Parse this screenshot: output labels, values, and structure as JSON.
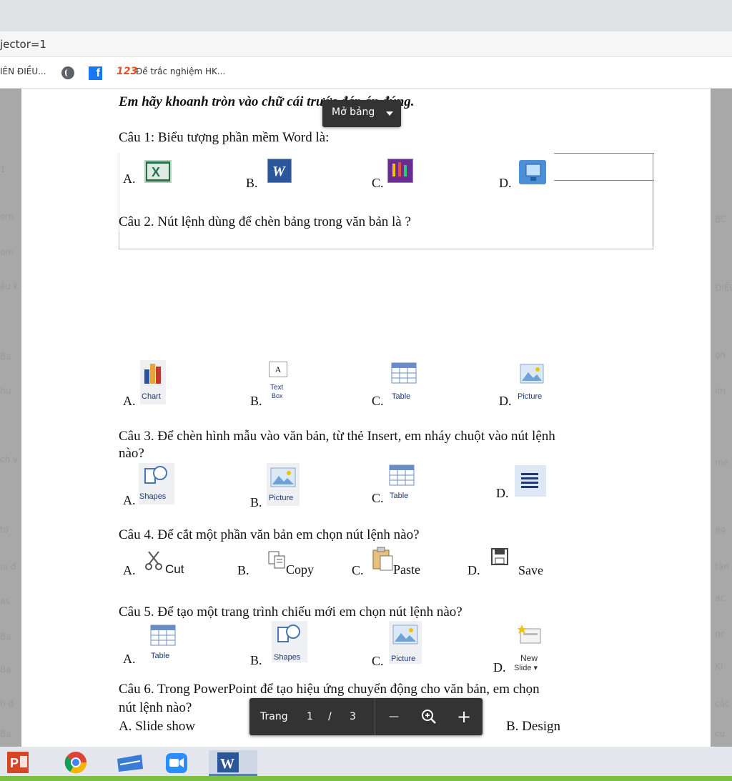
{
  "browser": {
    "address_fragment": "jector=1",
    "bookmarks": {
      "item1": "IÊN ĐIỀU...",
      "item2_prefix": "123",
      "item2": "Đề trắc nghiệm HK..."
    }
  },
  "viewer": {
    "open_table_button": "Mở bảng",
    "page_controls": {
      "page_label": "Trang",
      "current_page": "1",
      "separator": "/",
      "total_pages": "3",
      "zoom_out": "—",
      "zoom_in": "+"
    }
  },
  "document": {
    "instruction": "Em hãy khoanh tròn vào chữ cái trước đáp án đúng.",
    "q1": {
      "text": "Câu 1: Biểu tượng phần mềm Word là:",
      "options": [
        "A.",
        "B.",
        "C.",
        "D."
      ]
    },
    "q2": {
      "text": "Câu 2. Nút lệnh dùng để chèn bảng trong văn bản là ?",
      "options": [
        "A.",
        "B.",
        "C.",
        "D."
      ],
      "ribbon": [
        "Chart",
        "Text",
        "Box",
        "Table",
        "Picture"
      ],
      "textbox_glyph": "A"
    },
    "q3": {
      "text_line1": "Câu 3. Để chèn hình mẫu vào văn bản, từ thẻ Insert, em nháy chuột vào nút lệnh",
      "text_line2": "nào?",
      "options": [
        "A.",
        "B.",
        "C.",
        "D."
      ],
      "ribbon": [
        "Shapes",
        "Picture",
        "Table"
      ]
    },
    "q4": {
      "text": "Câu 4. Để cắt một phần văn bản em chọn nút lệnh nào?",
      "options": [
        "A.",
        "B.",
        "C.",
        "D."
      ],
      "labels": [
        "Cut",
        "Copy",
        "Paste",
        "Save"
      ]
    },
    "q5": {
      "text": "Câu 5.  Để tạo một trang trình chiếu mới em chọn nút lệnh nào?",
      "options": [
        "A.",
        "B.",
        "C.",
        "D."
      ],
      "ribbon": [
        "Table",
        "Shapes",
        "Picture",
        "New",
        "Slide ▾"
      ]
    },
    "q6": {
      "text_line1": "Câu 6.  Trong PowerPoint để tạo hiệu ứng chuyển động cho văn bản, em chọn",
      "text_line2": "nút lệnh nào?",
      "option_a": "A.  Slide show",
      "option_b": "B. Design"
    }
  },
  "ghost_left": [
    "1",
    "om",
    "om",
    "ều k",
    "Ba",
    "hư",
    "ch v",
    "to",
    "ıu đ",
    "as",
    "Ba",
    "Ba",
    "h đ",
    "Ba"
  ],
  "ghost_right": [
    "BC",
    "ĐIỀU",
    "ọn",
    "ìm",
    "me",
    "89",
    "tận",
    "ac.",
    "nc",
    "Ki",
    "các",
    "cu"
  ],
  "colors": {
    "word_blue": "#2b579a",
    "excel_green": "#217346",
    "ppt_orange": "#d24726",
    "viewer_dark": "#333333",
    "taskbar_green": "#7cc043"
  }
}
